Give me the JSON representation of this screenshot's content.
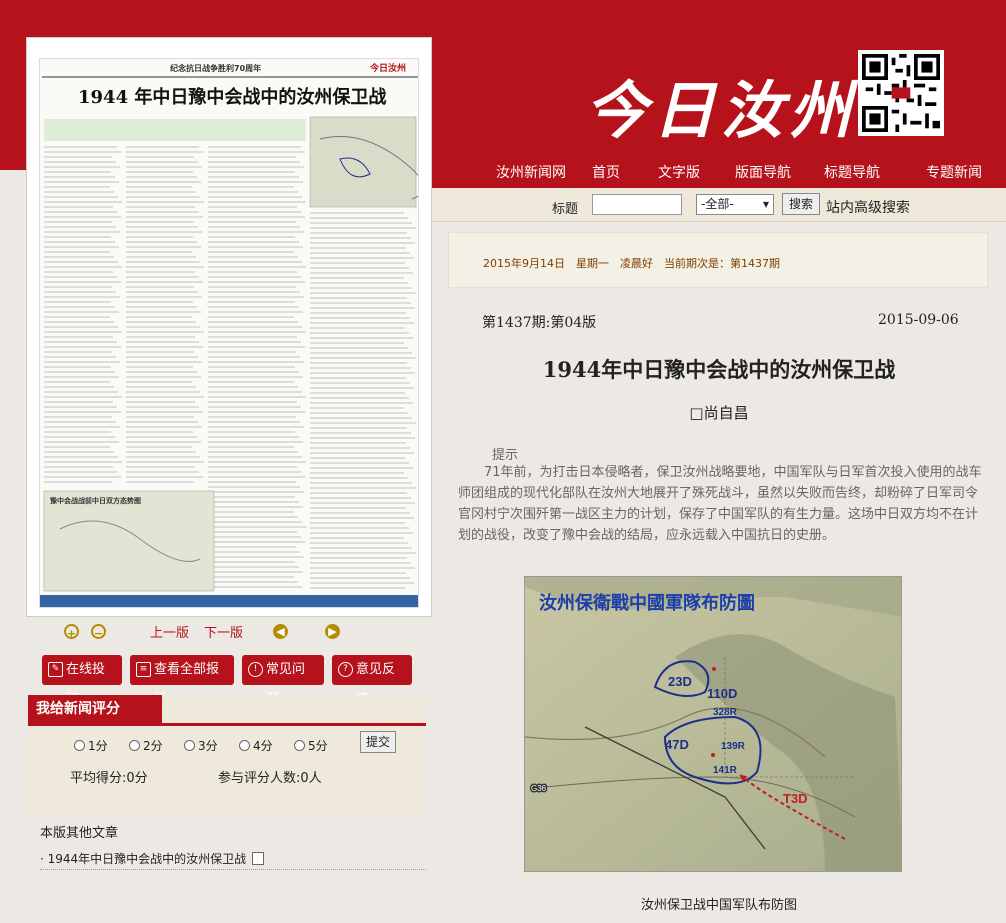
{
  "site": {
    "logo": "今日汝州"
  },
  "nav": {
    "items": [
      "汝州新闻网",
      "首页",
      "文字版",
      "版面导航",
      "标题导航",
      "专题新闻"
    ]
  },
  "search": {
    "label": "标题",
    "select_value": "-全部-",
    "button": "搜索",
    "advanced": "站内高级搜索"
  },
  "dateline": "2015年9月14日　星期一　凌晨好　当前期次是：第1437期",
  "article": {
    "issue": "第1437期:第04版",
    "date": "2015-09-06",
    "title": "1944年中日豫中会战中的汝州保卫战",
    "author": "□尚自昌",
    "tip_label": "提示",
    "summary": "71年前，为打击日本侵略者，保卫汝州战略要地，中国军队与日军首次投入使用的战车师团组成的现代化部队在汝州大地展开了殊死战斗，虽然以失败而告终，却粉碎了日军司令官冈村宁次围歼第一战区主力的计划，保存了中国军队的有生力量。这场中日双方均不在计划的战役，改变了豫中会战的结局，应永远载入中国抗日的史册。",
    "map_title": "汝州保衛戰中國軍隊布防圖",
    "map_labels": [
      "23D",
      "110D",
      "328R",
      "47D",
      "139R",
      "141R",
      "T3D",
      "G36"
    ],
    "caption": "汝州保卫战中国军队布防图"
  },
  "thumbnail": {
    "header_center": "纪念抗日战争胜利70周年",
    "header_right": "今日汝州",
    "title": "1944 年中日豫中会战中的汝州保卫战",
    "inset_title": "豫中会战战前中日双方态势图"
  },
  "pager": {
    "prev": "上一版",
    "next": "下一版"
  },
  "actions": [
    "在线投稿",
    "查看全部报纸",
    "常见问题",
    "意见反馈"
  ],
  "rating": {
    "tab": "我给新闻评分",
    "options": [
      "1分",
      "2分",
      "3分",
      "4分",
      "5分"
    ],
    "submit": "提交",
    "avg": "平均得分:0分",
    "count": "参与评分人数:0人"
  },
  "other": {
    "title": "本版其他文章",
    "items": [
      "1944年中日豫中会战中的汝州保卫战"
    ]
  },
  "colors": {
    "brand": "#b5121b",
    "panel": "#efe9dc",
    "bg": "#ece9e4"
  }
}
